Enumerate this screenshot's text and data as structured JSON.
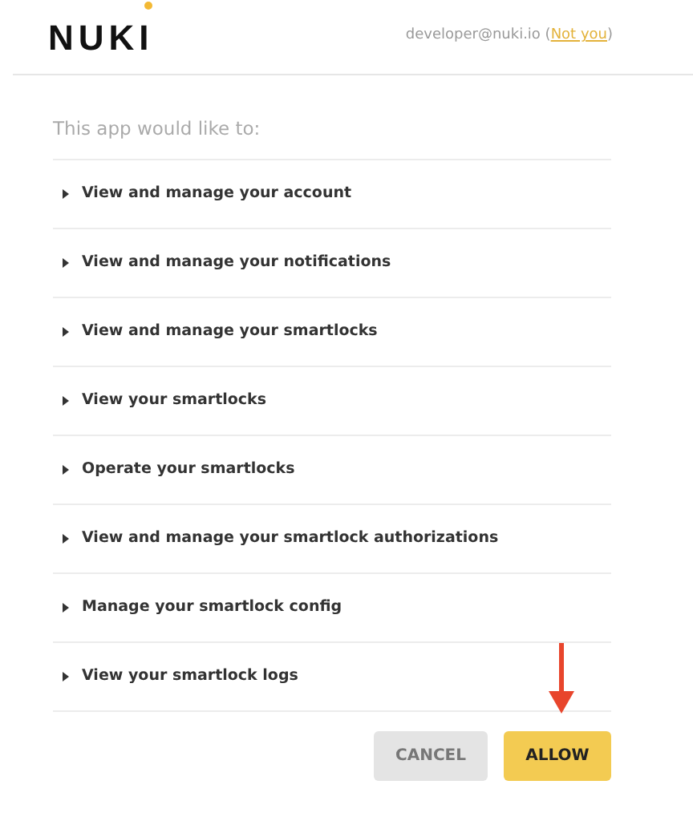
{
  "header": {
    "logo": "NUKI",
    "user_email": "developer@nuki.io (",
    "not_you_link": "Not you",
    "link_close": ")"
  },
  "heading": "This app would like to:",
  "permissions": [
    {
      "label": "View and manage your account"
    },
    {
      "label": "View and manage your notifications"
    },
    {
      "label": "View and manage your smartlocks"
    },
    {
      "label": "View your smartlocks"
    },
    {
      "label": "Operate your smartlocks"
    },
    {
      "label": "View and manage your smartlock authorizations"
    },
    {
      "label": "Manage your smartlock config"
    },
    {
      "label": "View your smartlock logs"
    }
  ],
  "buttons": [
    {
      "label": "CANCEL",
      "kind": "secondary"
    },
    {
      "label": "ALLOW",
      "kind": "primary"
    }
  ]
}
